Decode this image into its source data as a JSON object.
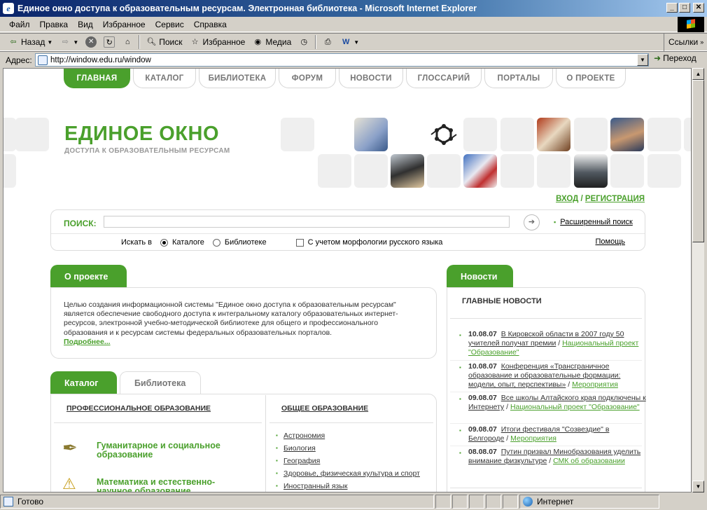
{
  "window": {
    "title": "Единое окно доступа к образовательным ресурсам. Электронная библиотека - Microsoft Internet Explorer"
  },
  "menu": [
    "Файл",
    "Правка",
    "Вид",
    "Избранное",
    "Сервис",
    "Справка"
  ],
  "toolbar": {
    "back": "Назад",
    "search": "Поиск",
    "favorites": "Избранное",
    "media": "Медиа",
    "links": "Ссылки"
  },
  "address": {
    "label": "Адрес:",
    "url": "http://window.edu.ru/window",
    "go": "Переход"
  },
  "nav": [
    "ГЛАВНАЯ",
    "КАТАЛОГ",
    "БИБЛИОТЕКА",
    "ФОРУМ",
    "НОВОСТИ",
    "ГЛОССАРИЙ",
    "ПОРТАЛЫ",
    "О ПРОЕКТЕ"
  ],
  "logo": {
    "title": "ЕДИНОЕ ОКНО",
    "subtitle": "ДОСТУПА К ОБРАЗОВАТЕЛЬНЫМ РЕСУРСАМ"
  },
  "auth": {
    "login": "ВХОД",
    "sep": "/",
    "register": "РЕГИСТРАЦИЯ"
  },
  "search": {
    "label": "ПОИСК:",
    "value": "",
    "advanced": "Расширенный поиск",
    "search_in": "Искать в",
    "opt_catalog": "Каталоге",
    "opt_library": "Библиотеке",
    "morph": "С учетом морфологии русского языка",
    "help": "Помощь"
  },
  "about": {
    "tab": "О проекте",
    "text": "Целью создания информационной системы \"Единое окно доступа к образовательным ресурсам\" является обеспечение свободного доступа к интегральному каталогу образовательных интернет-ресурсов, электронной учебно-методической библиотеке для общего и профессионального образования и к ресурсам системы федеральных образовательных порталов.",
    "more": "Подробнее..."
  },
  "catalog": {
    "tab_active": "Каталог",
    "tab_inactive": "Библиотека",
    "prof_header": "ПРОФЕССИОНАЛЬНОЕ ОБРАЗОВАНИЕ",
    "general_header": "ОБЩЕЕ ОБРАЗОВАНИЕ",
    "prof_items": [
      "Гуманитарное и социальное образование",
      "Математика и естественно-научное образование"
    ],
    "general_items": [
      "Астрономия",
      "Биология",
      "География",
      "Здоровье, физическая культура и спорт",
      "Иностранный язык"
    ]
  },
  "news": {
    "tab": "Новости",
    "heading": "ГЛАВНЫЕ НОВОСТИ",
    "items": [
      {
        "date": "10.08.07",
        "title": "В Кировской области в 2007 году 50 учителей получат премии",
        "sep": "/",
        "tag": "Национальный проект \"Образование\""
      },
      {
        "date": "10.08.07",
        "title": "Конференция «Трансграничное образование и образовательные формации: модели, опыт, перспективы»",
        "sep": "/",
        "tag": "Мероприятия"
      },
      {
        "date": "09.08.07",
        "title": "Все школы Алтайского края подключены к Интернету",
        "sep": "/",
        "tag": "Национальный проект \"Образование\""
      },
      {
        "date": "09.08.07",
        "title": "Итоги фестиваля \"Созвездие\" в Белгороде",
        "sep": "/",
        "tag": "Мероприятия"
      },
      {
        "date": "08.08.07",
        "title": "Путин призвал Минобразования уделить внимание физкультуре",
        "sep": "/",
        "tag": "СМК об образовании"
      }
    ]
  },
  "status": {
    "ready": "Готово",
    "zone": "Интернет"
  }
}
